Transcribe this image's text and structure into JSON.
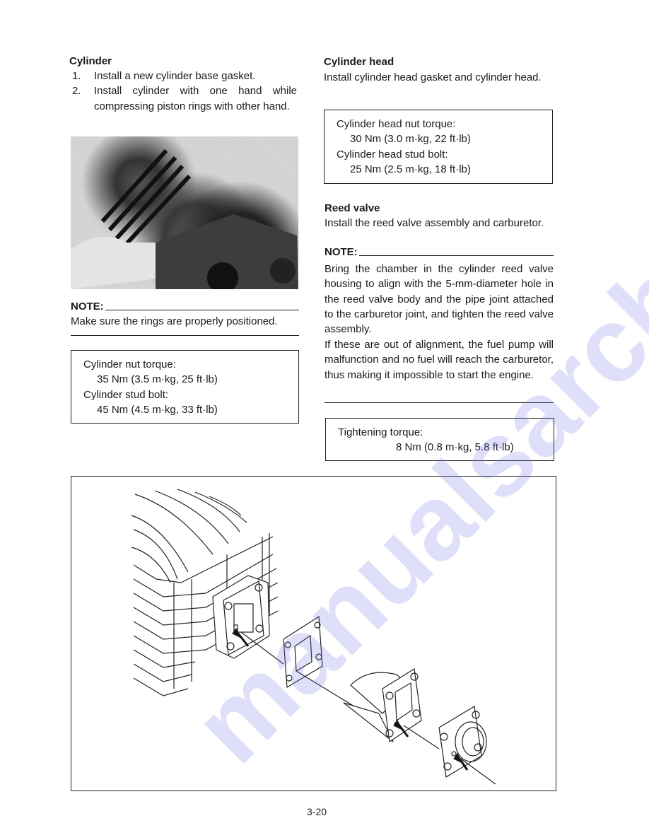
{
  "left": {
    "cylinder": {
      "heading": "Cylinder",
      "steps": [
        {
          "num": "1.",
          "text": "Install a new cylinder base gasket."
        },
        {
          "num": "2.",
          "text": "Install cylinder with one hand while compressing piston rings with other hand."
        }
      ]
    },
    "photo_label": "cylinder-installation-photo",
    "note": {
      "label": "NOTE:",
      "text": "Make sure the rings are properly positioned."
    },
    "torque_box": {
      "line1": "Cylinder nut torque:",
      "line2": "35 Nm (3.5 m·kg, 25 ft·lb)",
      "line3": "Cylinder stud bolt:",
      "line4": "45 Nm (4.5 m·kg, 33 ft·lb)"
    }
  },
  "right": {
    "cylinder_head": {
      "heading": "Cylinder head",
      "text": "Install cylinder head gasket and cylinder head."
    },
    "head_torque_box": {
      "line1": "Cylinder head nut torque:",
      "line2": "30 Nm (3.0 m·kg, 22 ft·lb)",
      "line3": "Cylinder head stud bolt:",
      "line4": "25 Nm (2.5 m·kg, 18 ft·lb)"
    },
    "reed_valve": {
      "heading": "Reed valve",
      "text": "Install the reed valve assembly and carburetor."
    },
    "note": {
      "label": "NOTE:",
      "para1": "Bring the chamber in the cylinder reed valve housing to align with the 5-mm-diameter hole in the reed valve body and the pipe joint attached to the carburetor joint, and tighten the reed valve assembly.",
      "para2": "If these are out of alignment, the fuel pump will malfunction and no fuel will reach the carburetor, thus making it impossible to start the engine."
    },
    "tightening_box": {
      "line1": "Tightening torque:",
      "line2": "8 Nm (0.8 m·kg, 5.8 ft·lb)"
    }
  },
  "diagram": {
    "label": "reed-valve-exploded-diagram"
  },
  "footer": {
    "page_number": "3-20"
  },
  "watermark": {
    "text": "manualsarchive.com",
    "color": "#6e6ee6"
  }
}
